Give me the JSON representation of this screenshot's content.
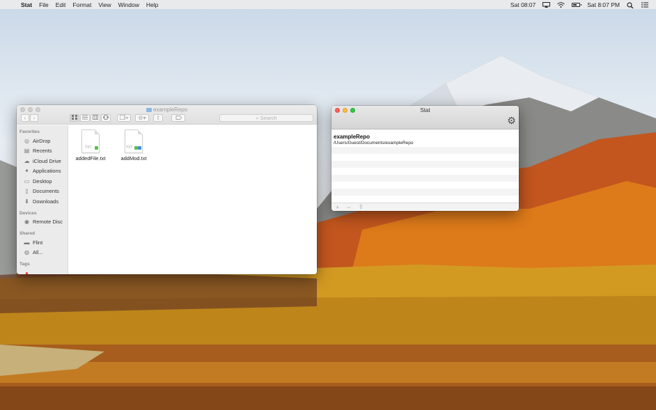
{
  "menubar": {
    "app_name": "Stat",
    "menus": [
      "File",
      "Edit",
      "Format",
      "View",
      "Window",
      "Help"
    ],
    "clock_short": "Sat 08:07",
    "clock_long": "Sat 8:07 PM"
  },
  "finder": {
    "title": "exampleRepo",
    "search_placeholder": "Search",
    "sidebar": {
      "favorites_header": "Favorites",
      "favorites": [
        {
          "label": "AirDrop",
          "icon": "airdrop-icon"
        },
        {
          "label": "Recents",
          "icon": "recents-icon"
        },
        {
          "label": "iCloud Drive",
          "icon": "cloud-icon"
        },
        {
          "label": "Applications",
          "icon": "applications-icon"
        },
        {
          "label": "Desktop",
          "icon": "desktop-icon"
        },
        {
          "label": "Documents",
          "icon": "documents-icon"
        },
        {
          "label": "Downloads",
          "icon": "downloads-icon"
        }
      ],
      "devices_header": "Devices",
      "devices": [
        {
          "label": "Remote Disc",
          "icon": "disc-icon"
        }
      ],
      "shared_header": "Shared",
      "shared": [
        {
          "label": "Flint",
          "icon": "network-computer-icon"
        },
        {
          "label": "All...",
          "icon": "network-globe-icon"
        }
      ],
      "tags_header": "Tags"
    },
    "files": [
      {
        "name": "addedFile.txt",
        "type_label": "TXT",
        "badge_colors": [
          "#5cc04a"
        ]
      },
      {
        "name": "addMod.txt",
        "type_label": "TXT",
        "badge_colors": [
          "#5cc04a",
          "#3d8fe0"
        ]
      }
    ]
  },
  "stat_window": {
    "title": "Stat",
    "repo_name": "exampleRepo",
    "repo_path": "/Users/Guest/Documents/exampleRepo",
    "bottom_buttons": {
      "add": "+",
      "remove": "−",
      "share": "⇪"
    }
  }
}
